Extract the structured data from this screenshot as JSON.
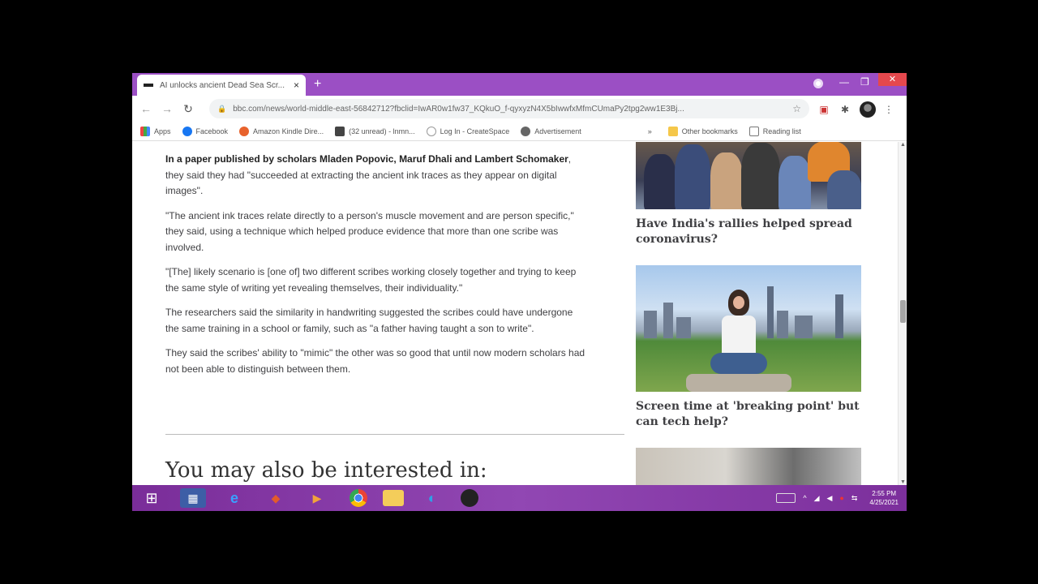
{
  "browser": {
    "tab_title": "AI unlocks ancient Dead Sea Scr...",
    "tab_close": "×",
    "new_tab": "+",
    "url": "bbc.com/news/world-middle-east-56842712?fbclid=IwAR0w1fw37_KQkuO_f-qyxyzN4X5bIwwfxMfmCUmaPy2tpg2ww1E3Bj...",
    "window_controls": {
      "minimize": "—",
      "maximize": "❐",
      "close": "✕"
    },
    "nav": {
      "back": "←",
      "forward": "→",
      "reload": "↻"
    }
  },
  "bookmarks": [
    {
      "label": "Apps"
    },
    {
      "label": "Facebook"
    },
    {
      "label": "Amazon Kindle Dire..."
    },
    {
      "label": "(32 unread) - lnmn..."
    },
    {
      "label": "Log In - CreateSpace"
    },
    {
      "label": "Advertisement"
    }
  ],
  "bookmarks_more": "»",
  "bookmarks_other": "Other bookmarks",
  "bookmarks_reading": "Reading list",
  "article": {
    "p1_bold": "In a paper published by scholars Mladen Popovic, Maruf Dhali and Lambert Schomaker",
    "p1_rest": ", they said they had \"succeeded at extracting the ancient ink traces as they appear on digital images\".",
    "p2": "\"The ancient ink traces relate directly to a person's muscle movement and are person specific,\" they said, using a technique which helped produce evidence that more than one scribe was involved.",
    "p3": "\"[The] likely scenario is [one of] two different scribes working closely together and trying to keep the same style of writing yet revealing themselves, their individuality.\"",
    "p4": "The researchers said the similarity in handwriting suggested the scribes could have undergone the same training in a school or family, such as \"a father having taught a son to write\".",
    "p5": "They said the scribes' ability to \"mimic\" the other was so good that until now modern scholars had not been able to distinguish between them.",
    "also_heading": "You may also be interested in:"
  },
  "sidebar": {
    "story1_title": "Have India's rallies helped spread coronavirus?",
    "story2_title": "Screen time at 'breaking point' but can tech help?"
  },
  "taskbar": {
    "start": "⊞",
    "clock_time": "2:55 PM",
    "clock_date": "4/25/2021"
  },
  "colors": {
    "browser_accent": "#9b4fc4",
    "taskbar": "#8a3fad",
    "close_button": "#e5484d"
  }
}
